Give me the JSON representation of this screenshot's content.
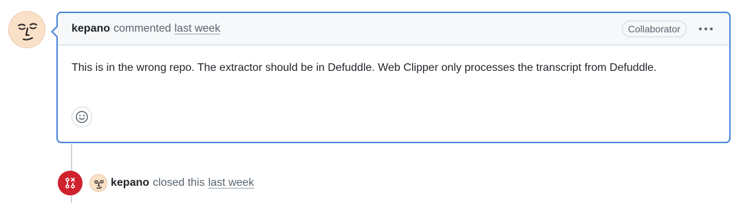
{
  "comment": {
    "author": "kepano",
    "action": "commented",
    "time": "last week",
    "role_badge": "Collaborator",
    "body": "This is in the wrong repo. The extractor should be in Defuddle. Web Clipper only processes the transcript from Defuddle.",
    "icons": {
      "avatar": "avatar-face-icon",
      "menu": "kebab-horizontal-icon",
      "reaction": "smiley-icon"
    }
  },
  "event": {
    "author": "kepano",
    "action": "closed this",
    "time": "last week",
    "icon": "git-pull-request-closed-icon",
    "icon_color": "#cf222e"
  },
  "colors": {
    "focus_border": "#4a86d9",
    "header_bg": "#f6f8fa",
    "muted_text": "#59636e"
  }
}
